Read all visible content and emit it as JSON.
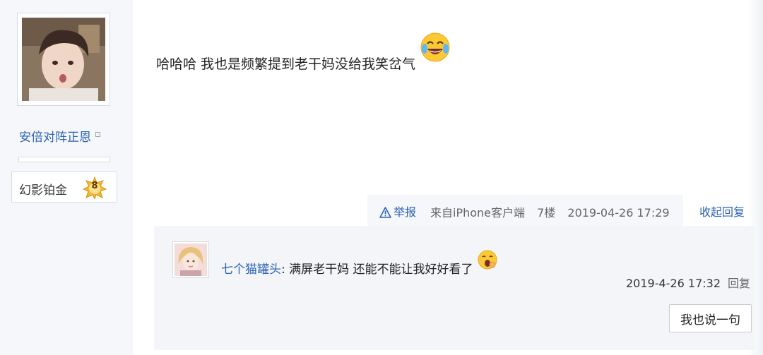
{
  "author": {
    "username": "安倍对阵正恩",
    "rank_name": "幻影铂金",
    "rank_level": "8",
    "avatar_icon": "user-avatar-photo"
  },
  "post": {
    "text": "哈哈哈 我也是频繁提到老干妈没给我笑岔气",
    "emoji_icon": "laugh-tears-emoji-icon"
  },
  "footer": {
    "report_label": "举报",
    "source": "来自iPhone客户端",
    "floor": "7楼",
    "datetime": "2019-04-26 17:29",
    "collapse_label": "收起回复"
  },
  "reply": {
    "username": "七个猫罐头",
    "separator": ":",
    "text": " 满屏老干妈 还能不能让我好好看了",
    "emoji_icon": "yawn-emoji-icon",
    "datetime": "2019-4-26 17:32",
    "reply_label": "回复"
  },
  "say_button_label": "我也说一句",
  "colors": {
    "link": "#2d64b3",
    "sidebar_bg": "#f5f7fa",
    "reply_bg": "#f3f5f8"
  }
}
